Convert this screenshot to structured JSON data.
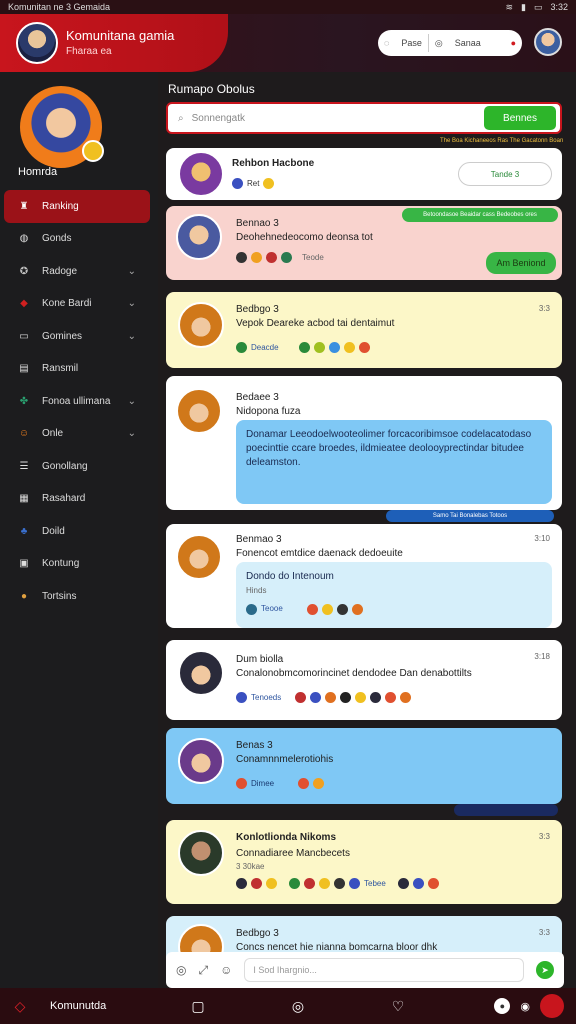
{
  "status_bar": {
    "title": "Komunitan ne 3 Gemaida",
    "time": "3:32"
  },
  "header": {
    "title": "Komunitana gamia",
    "subtitle": "Fharaa ea",
    "pill_left": "Pase",
    "pill_right": "Sanaa"
  },
  "sidebar": {
    "user_name": "Homrda",
    "items": [
      {
        "label": "Ranking",
        "icon": "trophy-icon",
        "chevron": false
      },
      {
        "label": "Gonds",
        "icon": "globe-icon",
        "chevron": false
      },
      {
        "label": "Radoge",
        "icon": "badge-icon",
        "chevron": true
      },
      {
        "label": "Kone Bardi",
        "icon": "game-icon",
        "chevron": true
      },
      {
        "label": "Gomines",
        "icon": "chat-icon",
        "chevron": true
      },
      {
        "label": "Ransmil",
        "icon": "document-icon",
        "chevron": false
      },
      {
        "label": "Fonoa ullimana",
        "icon": "puzzle-icon",
        "chevron": true
      },
      {
        "label": "Onle",
        "icon": "smile-icon",
        "chevron": true
      },
      {
        "label": "Gonollang",
        "icon": "list-icon",
        "chevron": false
      },
      {
        "label": "Rasahard",
        "icon": "board-icon",
        "chevron": false
      },
      {
        "label": "Doild",
        "icon": "people-icon",
        "chevron": false
      },
      {
        "label": "Kontung",
        "icon": "calendar-icon",
        "chevron": false
      },
      {
        "label": "Tortsins",
        "icon": "avatar-icon",
        "chevron": false
      }
    ]
  },
  "main": {
    "title": "Rumapo Obolus",
    "search_placeholder": "Sonnengatk",
    "search_button": "Bennes",
    "tiny_note": "The Boa Kichaneeos Ras The Gacatonn Boan",
    "posts": [
      {
        "name": "Rehbon Hacbone",
        "meta": "Ret",
        "pill": "Tande 3"
      },
      {
        "name": "Bennao 3",
        "msg": "Deohehnedeocomo deonsa tot",
        "reacts": "Teode",
        "top_pill": "Betoondasoe Beaidar cass Bedeobes ores",
        "action": "Am Beniond"
      },
      {
        "name": "Bedbgo 3",
        "msg": "Vepok Deareke acbod tai dentaimut",
        "reacts": "Deacde",
        "time": "3:3"
      },
      {
        "name": "Bedaee 3",
        "msg": "Nidopona fuza",
        "bubble": "Donamar Leeodoelwooteolimer forcacoribimsoe codelacatodaso poecinttie ccare broedes, ildmieatee deolooyprectindar bitudee deleamston.",
        "bluebar": "Samo Tai Bonalebas Totoos"
      },
      {
        "name": "Benmao 3",
        "msg": "Fonencot emtdice daenack dedoeuite",
        "bubble": "Dondo do Intenoum",
        "bubble2": "Hinds",
        "reacts": "Teooe",
        "time": "3:10"
      },
      {
        "name": "Dum biolla",
        "msg": "Conalonobmcomorincinet dendodee Dan denabottilts",
        "reacts": "Tenoeds",
        "time": "3:18"
      },
      {
        "name": "Benas 3",
        "msg": "Conamnnmelerotiohis",
        "reacts": "Dimee"
      },
      {
        "name": "Konlotlionda Nikoms",
        "msg": "Connadiaree Mancbecets",
        "sub": "3 30kae",
        "reacts": "Tebee",
        "time": "3:3"
      },
      {
        "name": "Bedbgo 3",
        "msg": "Concs nencet hie nianna bomcarna bloor dhk",
        "time": "3:3"
      }
    ]
  },
  "composer": {
    "placeholder": "I Sod Ihargnio..."
  },
  "bottom_bar": {
    "label": "Komunutda"
  },
  "colors": {
    "accent": "#c8151d",
    "green": "#2db52a",
    "blue_bubble": "#7fc8f5",
    "yellow_card": "#fcf7c8",
    "pink_card": "#f9d3ce"
  }
}
